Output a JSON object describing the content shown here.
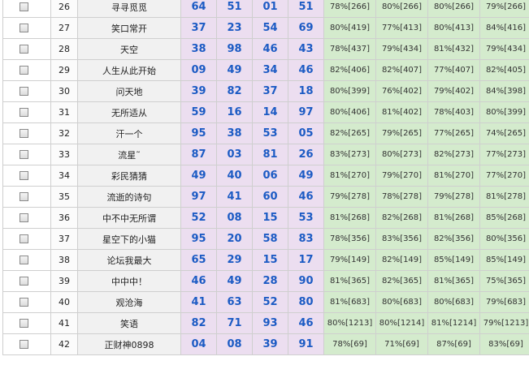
{
  "rows": [
    {
      "no": "26",
      "name": "寻寻觅觅",
      "draws": [
        "64",
        "51",
        "01",
        "51"
      ],
      "stats": [
        "78%[266]",
        "80%[266]",
        "80%[266]",
        "79%[266]"
      ]
    },
    {
      "no": "27",
      "name": "笑口常开",
      "draws": [
        "37",
        "23",
        "54",
        "69"
      ],
      "stats": [
        "80%[419]",
        "77%[413]",
        "80%[413]",
        "84%[416]"
      ]
    },
    {
      "no": "28",
      "name": "天空",
      "draws": [
        "38",
        "98",
        "46",
        "43"
      ],
      "stats": [
        "78%[437]",
        "79%[434]",
        "81%[432]",
        "79%[434]"
      ]
    },
    {
      "no": "29",
      "name": "人生从此开始",
      "draws": [
        "09",
        "49",
        "34",
        "46"
      ],
      "stats": [
        "82%[406]",
        "82%[407]",
        "77%[407]",
        "82%[405]"
      ]
    },
    {
      "no": "30",
      "name": "问天地",
      "draws": [
        "39",
        "82",
        "37",
        "18"
      ],
      "stats": [
        "80%[399]",
        "76%[402]",
        "79%[402]",
        "84%[398]"
      ]
    },
    {
      "no": "31",
      "name": "无所适从",
      "draws": [
        "59",
        "16",
        "14",
        "97"
      ],
      "stats": [
        "80%[406]",
        "81%[402]",
        "78%[403]",
        "80%[399]"
      ]
    },
    {
      "no": "32",
      "name": "汗一个",
      "draws": [
        "95",
        "38",
        "53",
        "05"
      ],
      "stats": [
        "82%[265]",
        "79%[265]",
        "77%[265]",
        "74%[265]"
      ]
    },
    {
      "no": "33",
      "name": "流星˜",
      "draws": [
        "87",
        "03",
        "81",
        "26"
      ],
      "stats": [
        "83%[273]",
        "80%[273]",
        "82%[273]",
        "77%[273]"
      ]
    },
    {
      "no": "34",
      "name": "彩民猜猜",
      "draws": [
        "49",
        "40",
        "06",
        "49"
      ],
      "stats": [
        "81%[270]",
        "79%[270]",
        "81%[270]",
        "77%[270]"
      ]
    },
    {
      "no": "35",
      "name": "流逝的诗句",
      "draws": [
        "97",
        "41",
        "60",
        "46"
      ],
      "stats": [
        "79%[278]",
        "78%[278]",
        "79%[278]",
        "81%[278]"
      ]
    },
    {
      "no": "36",
      "name": "中不中无所谓",
      "draws": [
        "52",
        "08",
        "15",
        "53"
      ],
      "stats": [
        "81%[268]",
        "82%[268]",
        "81%[268]",
        "85%[268]"
      ]
    },
    {
      "no": "37",
      "name": "星空下的小猫",
      "draws": [
        "95",
        "20",
        "58",
        "83"
      ],
      "stats": [
        "78%[356]",
        "83%[356]",
        "82%[356]",
        "80%[356]"
      ]
    },
    {
      "no": "38",
      "name": "论坛我最大",
      "draws": [
        "65",
        "29",
        "15",
        "17"
      ],
      "stats": [
        "79%[149]",
        "82%[149]",
        "85%[149]",
        "85%[149]"
      ]
    },
    {
      "no": "39",
      "name": "中中中！",
      "draws": [
        "46",
        "49",
        "28",
        "90"
      ],
      "stats": [
        "81%[365]",
        "82%[365]",
        "81%[365]",
        "75%[365]"
      ]
    },
    {
      "no": "40",
      "name": "观沧海",
      "draws": [
        "41",
        "63",
        "52",
        "80"
      ],
      "stats": [
        "81%[683]",
        "80%[683]",
        "80%[683]",
        "79%[683]"
      ]
    },
    {
      "no": "41",
      "name": "笑语",
      "draws": [
        "82",
        "71",
        "93",
        "46"
      ],
      "stats": [
        "80%[1213]",
        "80%[1214]",
        "81%[1214]",
        "79%[1213]"
      ]
    },
    {
      "no": "42",
      "name": "正财神0898",
      "draws": [
        "04",
        "08",
        "39",
        "91"
      ],
      "stats": [
        "78%[69]",
        "71%[69]",
        "87%[69]",
        "83%[69]"
      ]
    }
  ]
}
